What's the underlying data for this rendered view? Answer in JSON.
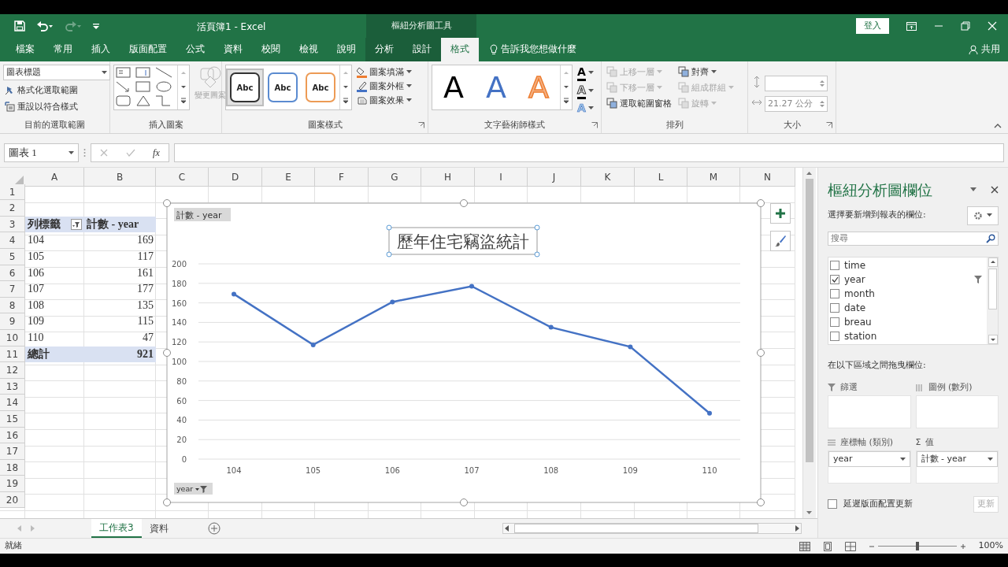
{
  "window": {
    "title": "活頁簿1 - Excel",
    "tools_title": "樞紐分析圖工具",
    "sign_in": "登入"
  },
  "ribbon_tabs": [
    {
      "label": "檔案",
      "selected": false,
      "contextual": false
    },
    {
      "label": "常用",
      "selected": false,
      "contextual": false
    },
    {
      "label": "插入",
      "selected": false,
      "contextual": false
    },
    {
      "label": "版面配置",
      "selected": false,
      "contextual": false
    },
    {
      "label": "公式",
      "selected": false,
      "contextual": false
    },
    {
      "label": "資料",
      "selected": false,
      "contextual": false
    },
    {
      "label": "校閱",
      "selected": false,
      "contextual": false
    },
    {
      "label": "檢視",
      "selected": false,
      "contextual": false
    },
    {
      "label": "說明",
      "selected": false,
      "contextual": false
    },
    {
      "label": "分析",
      "selected": false,
      "contextual": true
    },
    {
      "label": "設計",
      "selected": false,
      "contextual": true
    },
    {
      "label": "格式",
      "selected": true,
      "contextual": true
    }
  ],
  "tell_me": "告訴我您想做什麼",
  "share": "共用",
  "ribbon": {
    "selection": {
      "dropdown": "圖表標題",
      "commands": [
        "格式化選取範圍",
        "重設以符合樣式"
      ],
      "label": "目前的選取範圍"
    },
    "insert_shapes": {
      "change_shape": {
        "label": "變更圖案",
        "disabled": true
      },
      "label": "插入圖案"
    },
    "shape_styles": {
      "presets": [
        {
          "text": "Abc",
          "color": "#333333",
          "selected": true
        },
        {
          "text": "Abc",
          "color": "#5b8bd0",
          "selected": false
        },
        {
          "text": "Abc",
          "color": "#ed9b55",
          "selected": false
        }
      ],
      "commands": [
        "圖案填滿",
        "圖案外框",
        "圖案效果"
      ],
      "label": "圖案樣式"
    },
    "wordart": {
      "presets": [
        {
          "text": "A",
          "color": "#000000"
        },
        {
          "text": "A",
          "color": "#4472c4"
        },
        {
          "text": "A",
          "color": "#f4b183"
        }
      ],
      "tools": [
        {
          "text": "A",
          "kind": "fill"
        },
        {
          "text": "A",
          "kind": "outline"
        },
        {
          "text": "A",
          "kind": "effect"
        }
      ],
      "label": "文字藝術師樣式"
    },
    "arrange": {
      "commands": [
        {
          "label": "上移一層",
          "disabled": true
        },
        {
          "label": "下移一層",
          "disabled": true
        },
        {
          "label": "選取範圍窗格",
          "disabled": false
        },
        {
          "label": "對齊",
          "disabled": false
        },
        {
          "label": "組成群組",
          "disabled": true
        },
        {
          "label": "旋轉",
          "disabled": true
        }
      ],
      "label": "排列"
    },
    "size": {
      "width": "21.27 公分",
      "label": "大小"
    }
  },
  "formula_bar": {
    "name_box": "圖表 1",
    "function_label": "fx"
  },
  "sheet": {
    "columns": [
      "A",
      "B",
      "C",
      "D",
      "E",
      "F",
      "G",
      "H",
      "I",
      "J",
      "K",
      "L",
      "M",
      "N"
    ],
    "rows": [
      "1",
      "2",
      "3",
      "4",
      "5",
      "6",
      "7",
      "8",
      "9",
      "10",
      "11",
      "12",
      "13",
      "14",
      "15",
      "16",
      "17",
      "18",
      "19",
      "20"
    ],
    "pivot": {
      "header": [
        "列標籤",
        "計數 - year"
      ],
      "rows": [
        {
          "label": "104",
          "value": "169"
        },
        {
          "label": "105",
          "value": "117"
        },
        {
          "label": "106",
          "value": "161"
        },
        {
          "label": "107",
          "value": "177"
        },
        {
          "label": "108",
          "value": "135"
        },
        {
          "label": "109",
          "value": "115"
        },
        {
          "label": "110",
          "value": "47"
        }
      ],
      "total": {
        "label": "總計",
        "value": "921"
      }
    }
  },
  "chart": {
    "axis_button": "year",
    "chart_data": {
      "type": "line",
      "title": "歷年住宅竊盜統計",
      "categories": [
        "104",
        "105",
        "106",
        "107",
        "108",
        "109",
        "110"
      ],
      "series": [
        {
          "name": "計數 - year",
          "color": "#4472c4",
          "marker": "circle",
          "values": [
            169,
            117,
            161,
            177,
            135,
            115,
            47
          ]
        }
      ],
      "grid": true,
      "ylim": [
        0,
        200
      ],
      "yticks": [
        0,
        20,
        40,
        60,
        80,
        100,
        120,
        140,
        160,
        180,
        200
      ]
    }
  },
  "sheet_tabs": [
    {
      "label": "工作表3",
      "selected": true
    },
    {
      "label": "資料",
      "selected": false
    }
  ],
  "pivot_pane": {
    "title": "樞紐分析圖欄位",
    "subtitle": "選擇要新增到報表的欄位:",
    "search_placeholder": "搜尋",
    "fields": [
      {
        "name": "time",
        "checked": false,
        "filtered": false
      },
      {
        "name": "year",
        "checked": true,
        "filtered": true
      },
      {
        "name": "month",
        "checked": false,
        "filtered": false
      },
      {
        "name": "date",
        "checked": false,
        "filtered": false
      },
      {
        "name": "breau",
        "checked": false,
        "filtered": false
      },
      {
        "name": "station",
        "checked": false,
        "filtered": false
      }
    ],
    "drag_hint": "在以下區域之間拖曳欄位:",
    "areas": [
      {
        "kind": "filter",
        "label": "篩選"
      },
      {
        "kind": "legend",
        "label": "圖例 (數列)"
      },
      {
        "kind": "axis",
        "label": "座標軸 (類別)",
        "items": [
          "year"
        ]
      },
      {
        "kind": "values",
        "label": "值",
        "symbol": "Σ",
        "items": [
          "計數 - year"
        ]
      }
    ],
    "defer": {
      "label": "延遲版面配置更新",
      "checked": false
    },
    "update_button": {
      "label": "更新",
      "disabled": true
    }
  },
  "status_bar": {
    "text": "就緒",
    "zoom": "100%",
    "zoom_slider": {
      "level": 0.5
    }
  }
}
